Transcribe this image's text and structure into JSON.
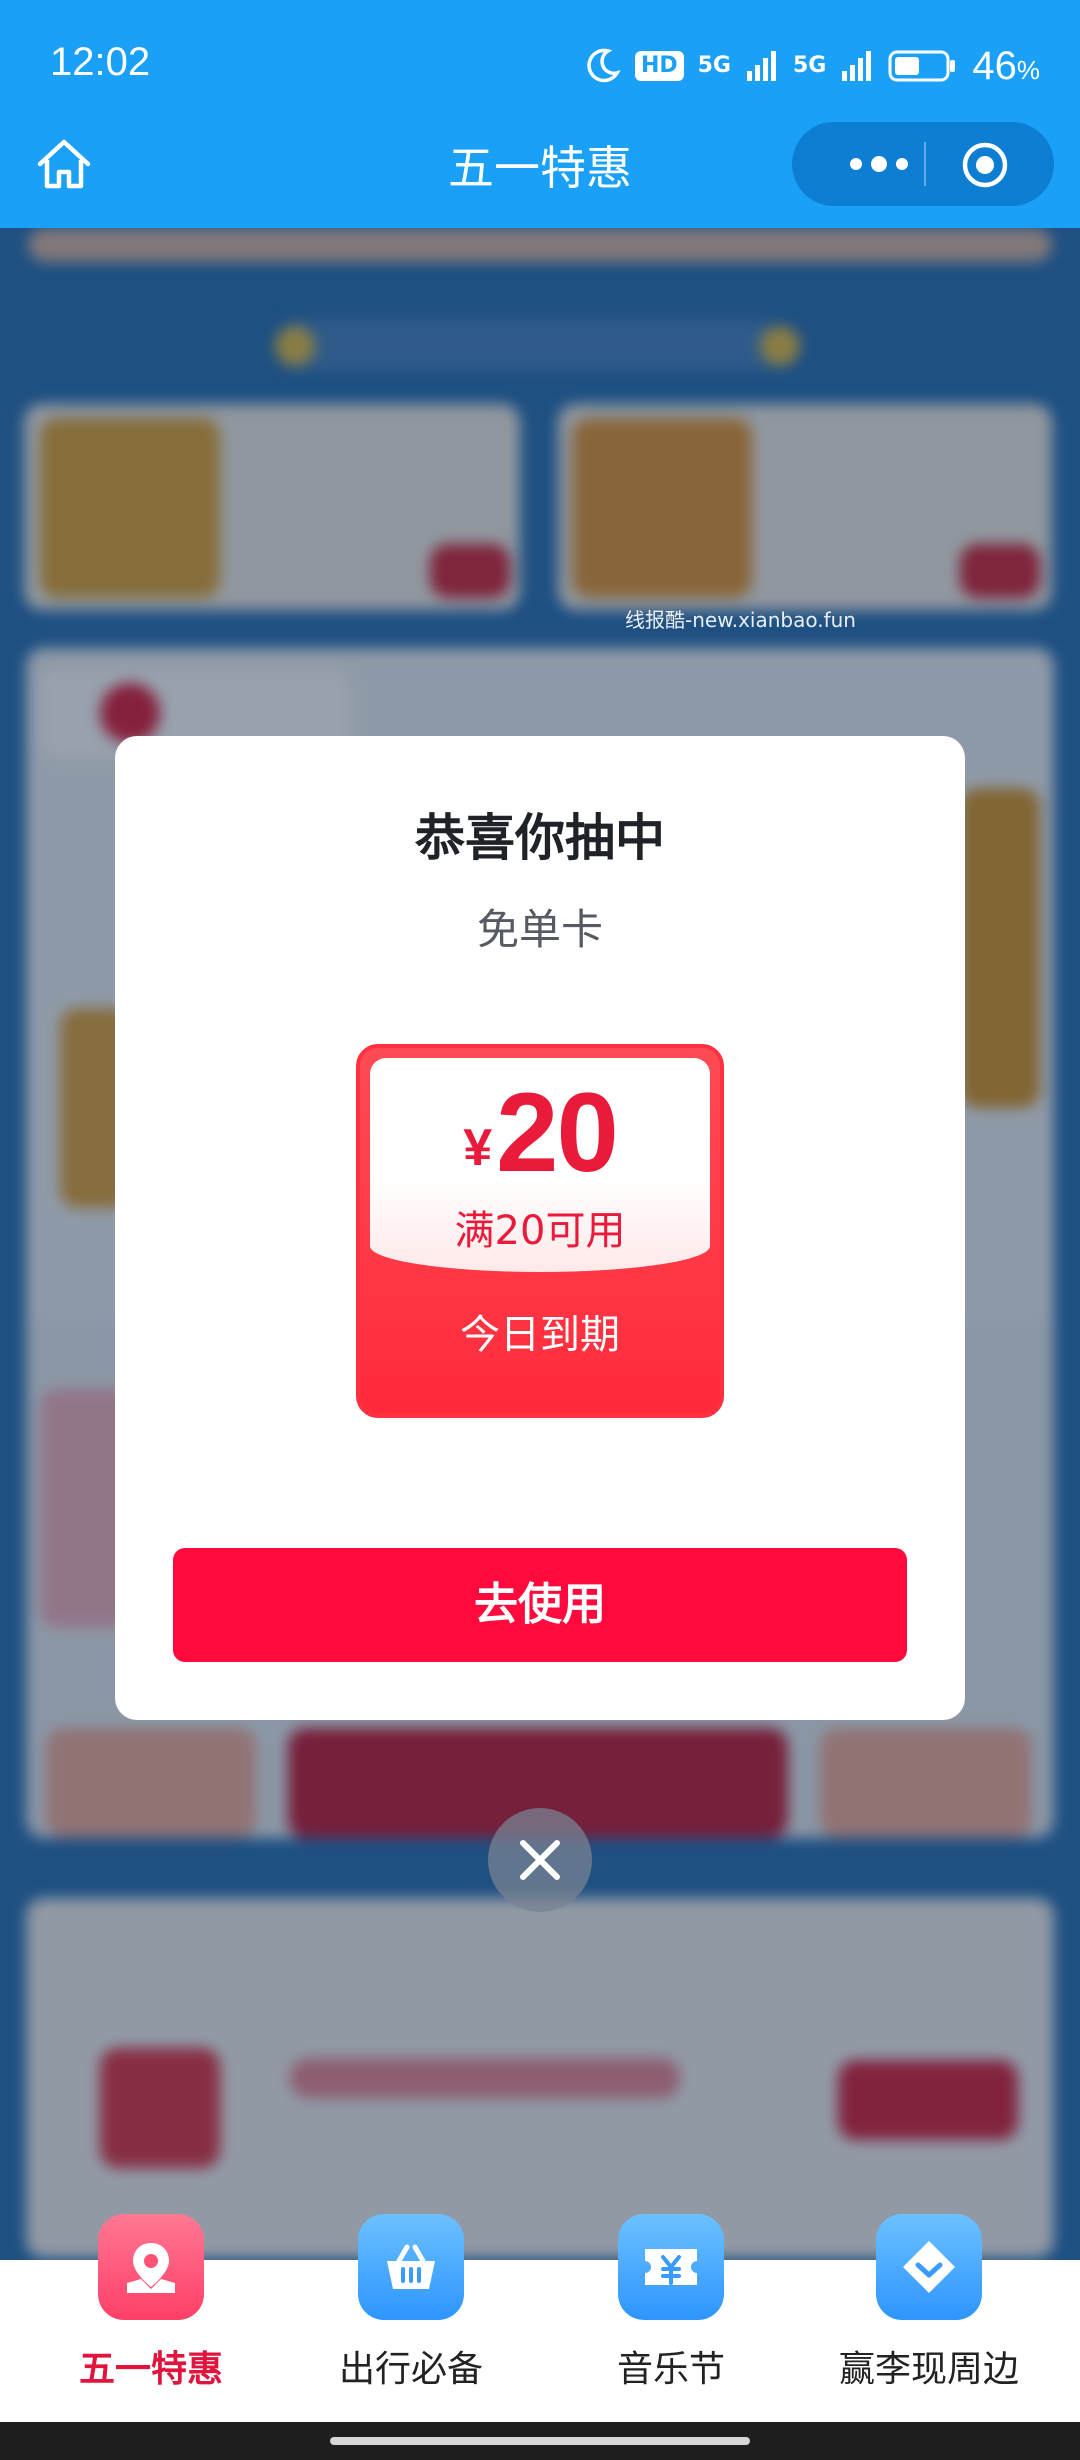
{
  "status_bar": {
    "time": "12:02",
    "hd_label": "HD",
    "net1": "5G",
    "net2": "5G",
    "battery_percent": "46",
    "percent_sign": "%"
  },
  "title_bar": {
    "title": "五一特惠",
    "home_icon": "home-icon",
    "more_icon": "more-dots-icon",
    "close_icon": "mini-program-close-icon"
  },
  "watermark": "线报酷-new.xianbao.fun",
  "modal": {
    "title": "恭喜你抽中",
    "subtitle": "免单卡",
    "coupon": {
      "currency": "¥",
      "amount": "20",
      "condition": "满20可用",
      "expiry": "今日到期"
    },
    "use_button": "去使用"
  },
  "tabs": [
    {
      "label": "五一特惠",
      "icon": "map-pin-icon",
      "active": true,
      "color": "#ff4f7a"
    },
    {
      "label": "出行必备",
      "icon": "shopping-basket-icon",
      "active": false,
      "color": "#3ea7ff"
    },
    {
      "label": "音乐节",
      "icon": "ticket-icon",
      "active": false,
      "color": "#3ea7ff"
    },
    {
      "label": "赢李现周边",
      "icon": "diamond-icon",
      "active": false,
      "color": "#3ea7ff"
    }
  ],
  "colors": {
    "title_bar": "#1aa0f7",
    "primary_red": "#ff0a3c",
    "active_tab": "#e0143d"
  }
}
